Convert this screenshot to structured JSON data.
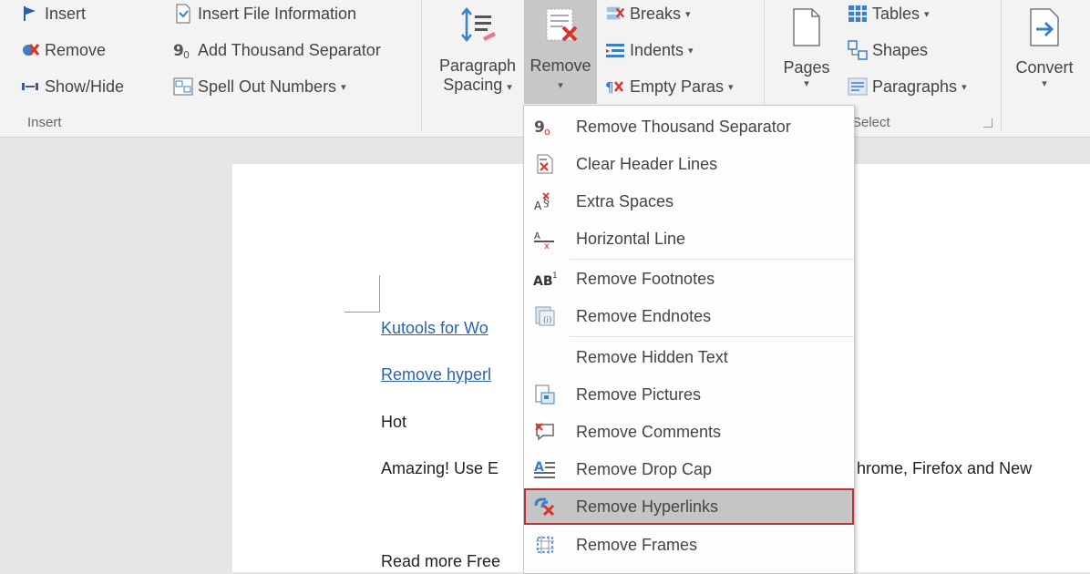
{
  "ribbon": {
    "insert_group": {
      "label": "Insert",
      "insert": "Insert",
      "remove": "Remove",
      "show_hide": "Show/Hide"
    },
    "file_group": {
      "insert_file_info": "Insert File Information",
      "add_thousand_separator": "Add Thousand Separator",
      "spell_out_numbers": "Spell Out Numbers"
    },
    "paragraph_spacing": {
      "line1": "Paragraph",
      "line2": "Spacing"
    },
    "remove_btn": "Remove",
    "remove_small": {
      "breaks": "Breaks",
      "indents": "Indents",
      "empty_paras": "Empty Paras"
    },
    "pages": "Pages",
    "select_group": {
      "label": "Select",
      "tables": "Tables",
      "shapes": "Shapes",
      "paragraphs": "Paragraphs"
    },
    "convert": "Convert"
  },
  "document": {
    "link1": "Kutools for Wo",
    "link2": "Remove hyperl",
    "line_hot": "Hot",
    "line_amazing": "Amazing! Use E",
    "line_amazing_right": "hrome, Firefox and New",
    "line_read_more": "Read more Free"
  },
  "menu": {
    "items": [
      {
        "label": "Remove Thousand Separator",
        "icon": "thousand-separator-icon"
      },
      {
        "label": "Clear Header Lines",
        "icon": "header-lines-icon"
      },
      {
        "label": "Extra Spaces",
        "icon": "extra-spaces-icon"
      },
      {
        "label": "Horizontal Line",
        "icon": "horizontal-line-icon"
      },
      {
        "label": "Remove Footnotes",
        "icon": "footnotes-icon"
      },
      {
        "label": "Remove Endnotes",
        "icon": "endnotes-icon"
      },
      {
        "label": "Remove Hidden Text",
        "icon": ""
      },
      {
        "label": "Remove Pictures",
        "icon": "pictures-icon"
      },
      {
        "label": "Remove Comments",
        "icon": "comments-icon"
      },
      {
        "label": "Remove Drop Cap",
        "icon": "drop-cap-icon"
      },
      {
        "label": "Remove Hyperlinks",
        "icon": "hyperlinks-icon"
      },
      {
        "label": "Remove Frames",
        "icon": "frames-icon"
      }
    ],
    "highlighted": "Remove Hyperlinks"
  },
  "colors": {
    "accent_red": "#b8323a",
    "link_blue": "#2a62b6",
    "icon_blue": "#3b7fc4",
    "icon_red": "#d6342c"
  }
}
